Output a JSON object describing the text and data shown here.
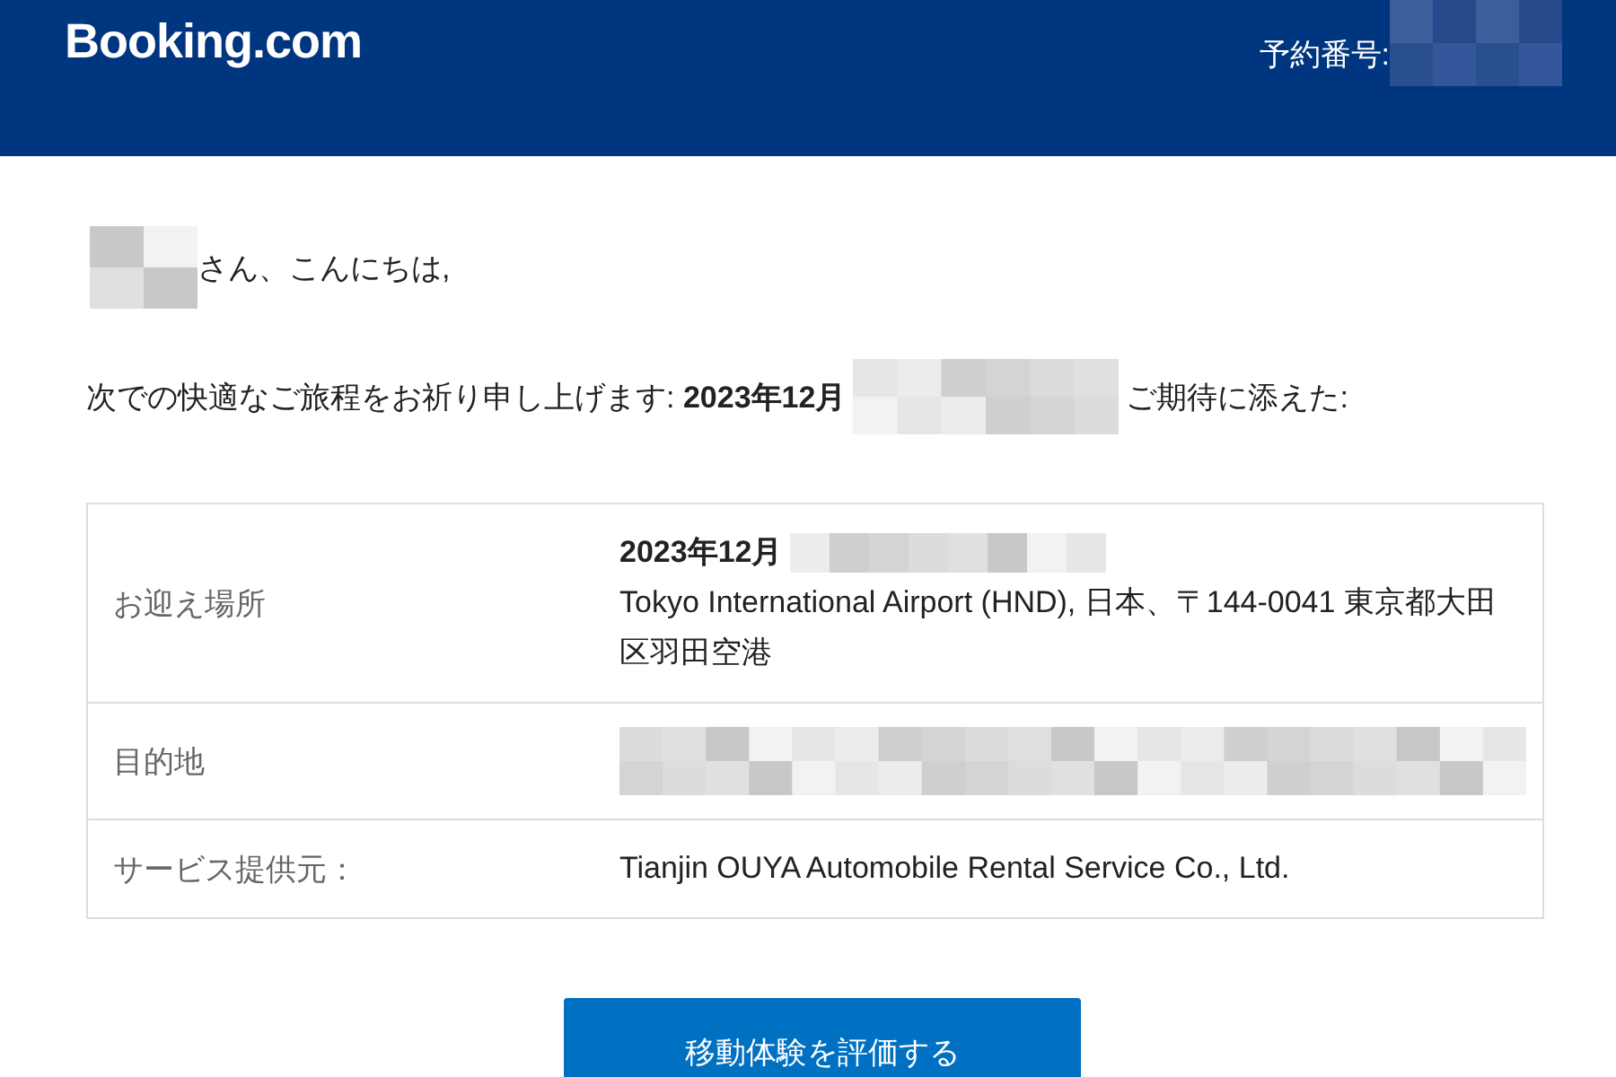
{
  "header": {
    "logo": "Booking.com",
    "reservation_label": "予約番号:"
  },
  "greeting": {
    "text": "さん、こんにちは,"
  },
  "intro": {
    "before": "次での快適なご旅程をお祈り申し上げます:",
    "date": "2023年12月",
    "after": "ご期待に添えた:"
  },
  "details": [
    {
      "label": "お迎え場所",
      "date": "2023年12月",
      "value": "Tokyo International Airport (HND), 日本、〒144-0041 東京都大田区羽田空港"
    },
    {
      "label": "目的地"
    },
    {
      "label": "サービス提供元：",
      "value": "Tianjin OUYA Automobile Rental Service Co., Ltd."
    }
  ],
  "button": {
    "label": "移動体験を評価する"
  }
}
